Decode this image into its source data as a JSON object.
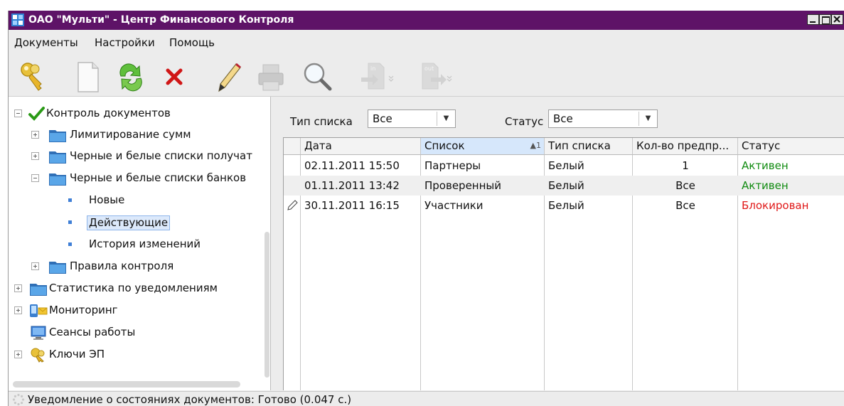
{
  "window": {
    "title": "ОАО \"Мульти\" - Центр Финансового Контроля"
  },
  "menu": [
    "Документы",
    "Настройки",
    "Помощь"
  ],
  "toolbar": [
    {
      "name": "keys-icon"
    },
    {
      "name": "new-document-icon"
    },
    {
      "name": "refresh-icon"
    },
    {
      "name": "delete-icon"
    },
    {
      "name": "edit-icon"
    },
    {
      "name": "print-icon"
    },
    {
      "name": "search-icon"
    },
    {
      "name": "import-icon",
      "label": "in"
    },
    {
      "name": "export-icon",
      "label": "out"
    }
  ],
  "tree": {
    "root": "Контроль документов",
    "items": [
      "Лимитирование сумм",
      "Черные и белые списки получат",
      "Черные и белые списки банков",
      "Новые",
      "Действующие",
      "История изменений",
      "Правила контроля",
      "Статистика по уведомлениям",
      "Мониторинг",
      "Сеансы работы",
      "Ключи ЭП"
    ]
  },
  "filters": {
    "type_label": "Тип списка",
    "type_value": "Все",
    "status_label": "Статус",
    "status_value": "Все"
  },
  "table": {
    "columns": [
      "Дата",
      "Список",
      "Тип списка",
      "Кол-во предпр...",
      "Статус"
    ],
    "sort_indicator": "▲1",
    "rows": [
      {
        "date": "02.11.2011 15:50",
        "list": "Партнеры",
        "type": "Белый",
        "count": "1",
        "status": "Активен"
      },
      {
        "date": "01.11.2011 13:42",
        "list": "Проверенный",
        "type": "Белый",
        "count": "Все",
        "status": "Активен"
      },
      {
        "date": "30.11.2011 16:15",
        "list": "Участники",
        "type": "Белый",
        "count": "Все",
        "status": "Блокирован"
      }
    ]
  },
  "status_bar": {
    "text": "Уведомление о состояниях документов: Готово (0.047 с.)"
  },
  "colors": {
    "titlebar": "#5e1367",
    "active": "#118b11",
    "blocked": "#e01818",
    "selection": "#dce9fb"
  }
}
